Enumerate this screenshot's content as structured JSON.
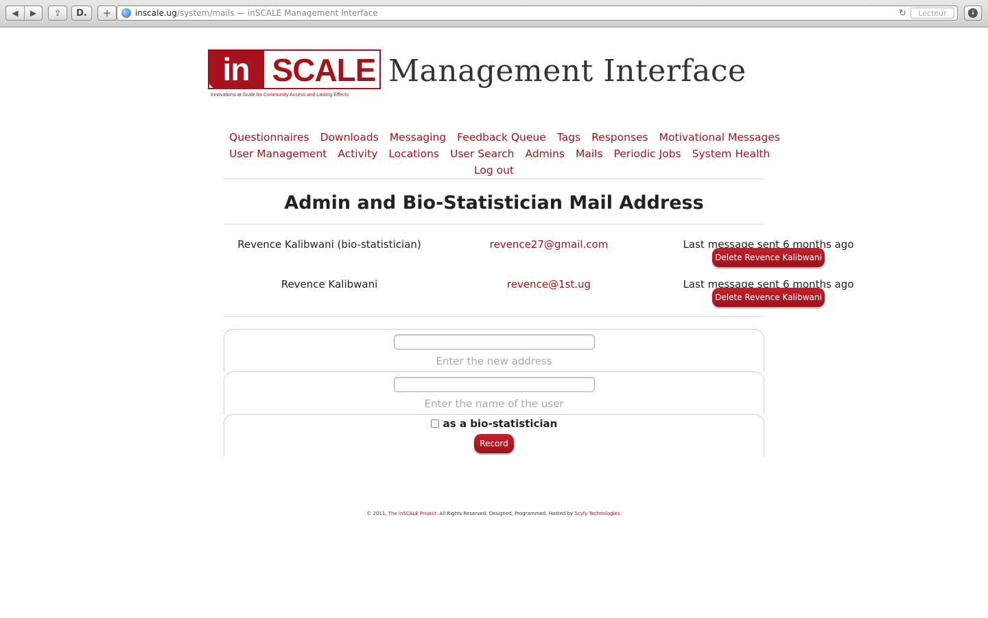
{
  "browser": {
    "url_host": "inscale.ug",
    "url_path": "/system/mails",
    "tab_title": " — inSCALE Management Interface",
    "reader_label": "Lecteur",
    "back_glyph": "◀",
    "forward_glyph": "▶",
    "share_glyph": "⇪",
    "readlater_glyph": "D.",
    "newtab_glyph": "+",
    "reload_glyph": "↻",
    "download_glyph": "↓"
  },
  "header": {
    "logo_in": "in",
    "logo_scale": "SCALE",
    "logo_tagline": "Innovations at Scale for Community Access and Lasting Effects",
    "title": "Management Interface"
  },
  "nav": {
    "items": [
      "Questionnaires",
      "Downloads",
      "Messaging",
      "Feedback Queue",
      "Tags",
      "Responses",
      "Motivational Messages",
      "User Management",
      "Activity",
      "Locations",
      "User Search",
      "Admins",
      "Mails",
      "Periodic Jobs",
      "System Health",
      "Log out"
    ]
  },
  "page": {
    "title": "Admin and Bio-Statistician Mail Address"
  },
  "mails": [
    {
      "name": "Revence Kalibwani (bio-statistician)",
      "email": "revence27@gmail.com",
      "last_message": "Last message sent 6 months ago",
      "delete_label": "Delete Revence Kalibwani"
    },
    {
      "name": "Revence Kalibwani",
      "email": "revence@1st.ug",
      "last_message": "Last message sent 6 months ago",
      "delete_label": "Delete Revence Kalibwani"
    }
  ],
  "form": {
    "address_hint": "Enter the new address",
    "name_hint": "Enter the name of the user",
    "bio_label": "as a bio-statistician",
    "bio_checked": false,
    "record_label": "Record"
  },
  "footer": {
    "prefix": "© 2011,",
    "project_link": "The inSCALE Project",
    "middle": ". All Rights Reserved. Designed, Programmed, Hosted by",
    "company_link": "Scyfy Technologies",
    "suffix": "."
  },
  "colors": {
    "accent": "#a8121c",
    "hint": "#aaaaaa"
  }
}
